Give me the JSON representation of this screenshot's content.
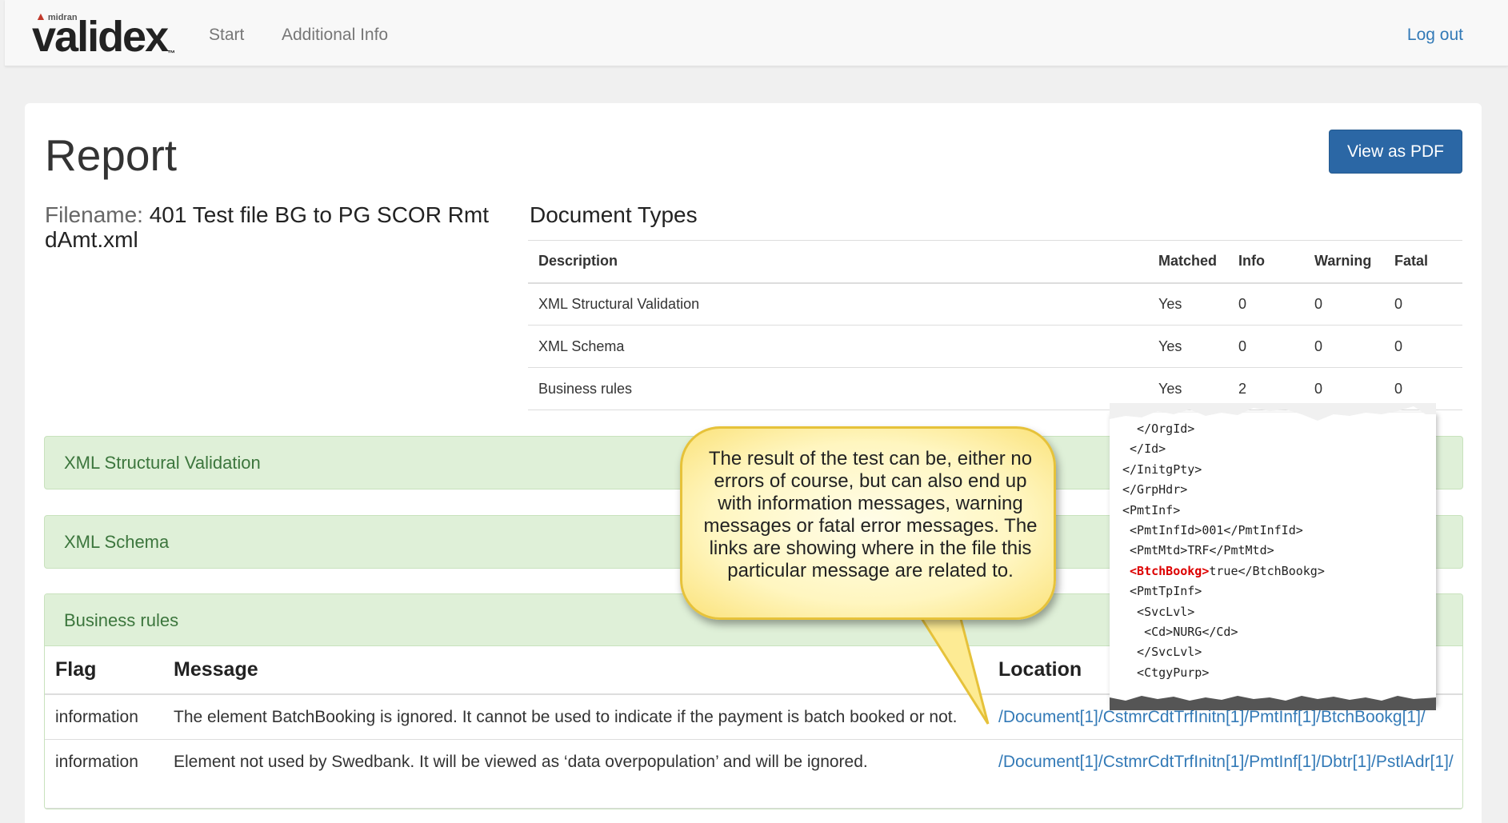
{
  "brand": {
    "maker": "midran",
    "name": "validex",
    "tm": "™"
  },
  "nav": {
    "start": "Start",
    "additional_info": "Additional Info",
    "logout": "Log out"
  },
  "report": {
    "title": "Report",
    "pdf_button": "View as PDF",
    "filename_label": "Filename:",
    "filename": "401 Test file BG to PG SCOR Rmt dAmt.xml"
  },
  "doc_types": {
    "title": "Document Types",
    "headers": {
      "description": "Description",
      "matched": "Matched",
      "info": "Info",
      "warning": "Warning",
      "fatal": "Fatal"
    },
    "rows": [
      {
        "description": "XML Structural Validation",
        "matched": "Yes",
        "info": "0",
        "warning": "0",
        "fatal": "0"
      },
      {
        "description": "XML Schema",
        "matched": "Yes",
        "info": "0",
        "warning": "0",
        "fatal": "0"
      },
      {
        "description": "Business rules",
        "matched": "Yes",
        "info": "2",
        "warning": "0",
        "fatal": "0"
      }
    ]
  },
  "sections": {
    "structural": "XML Structural Validation",
    "schema": "XML Schema",
    "business": "Business rules"
  },
  "rules_table": {
    "headers": {
      "flag": "Flag",
      "message": "Message",
      "location": "Location"
    },
    "rows": [
      {
        "flag": "information",
        "message": "The element BatchBooking is ignored. It cannot be used to indicate if the payment is batch booked or not.",
        "location": "/Document[1]/CstmrCdtTrfInitn[1]/PmtInf[1]/BtchBookg[1]/"
      },
      {
        "flag": "information",
        "message": "Element not used by Swedbank. It will be viewed as ‘data overpopulation’ and will be ignored.",
        "location": "/Document[1]/CstmrCdtTrfInitn[1]/PmtInf[1]/Dbtr[1]/PstlAdr[1]/"
      }
    ]
  },
  "callout": {
    "text": "The result of the test can be, either no errors of course, but can also end up with information messages, warning messages or fatal error messages. The links are showing where in the file this particular message are related to."
  },
  "xml_snippet": {
    "lines": [
      "  </OrgId>",
      " </Id>",
      "</InitgPty>",
      "</GrpHdr>",
      "<PmtInf>",
      " <PmtInfId>001</PmtInfId>",
      " <PmtMtd>TRF</PmtMtd>",
      " <BtchBookg>true</BtchBookg>",
      " <PmtTpInf>",
      "  <SvcLvl>",
      "   <Cd>NURG</Cd>",
      "  </SvcLvl>",
      "  <CtgyPurp>"
    ],
    "highlight_tag": "<BtchBookg>",
    "highlight_color": "#dd0000"
  }
}
